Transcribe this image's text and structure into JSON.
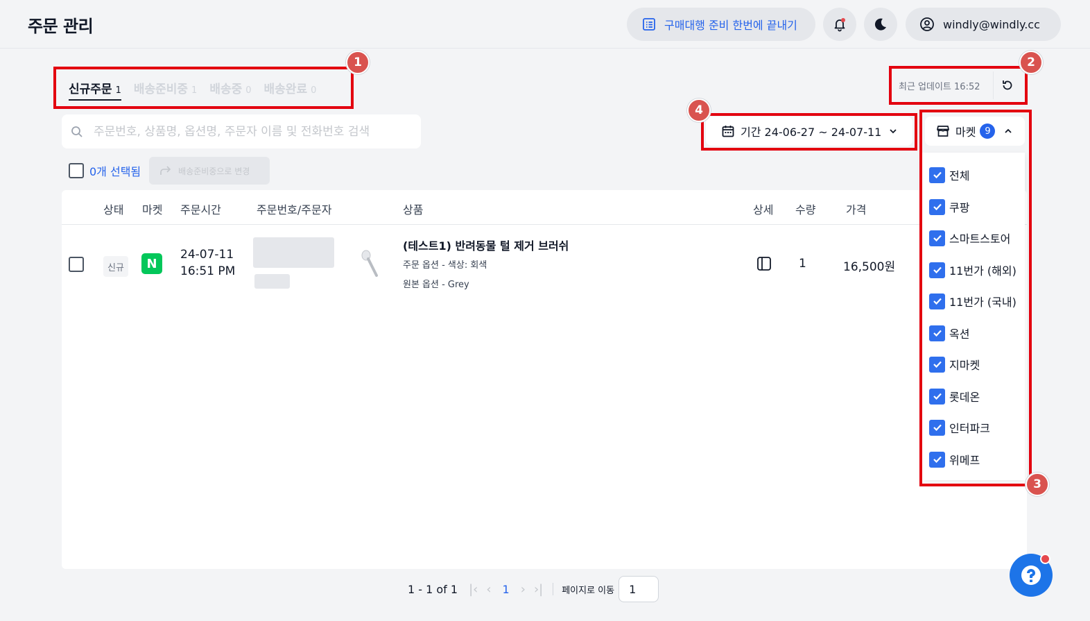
{
  "header": {
    "title": "주문 관리",
    "promo_label": "구매대행 준비 한번에 끝내기",
    "user_email": "windly@windly.cc"
  },
  "tabs": [
    {
      "label": "신규주문",
      "count": "1"
    },
    {
      "label": "배송준비중",
      "count": "1"
    },
    {
      "label": "배송중",
      "count": "0"
    },
    {
      "label": "배송완료",
      "count": "0"
    }
  ],
  "update": {
    "label": "최근 업데이트 16:52"
  },
  "search": {
    "placeholder": "주문번호, 상품명, 옵션명, 주문자 이름 및 전화번호 검색"
  },
  "period": {
    "label": "기간 24-06-27 ~ 24-07-11"
  },
  "market_filter": {
    "label": "마켓",
    "count": "9",
    "options": [
      "전체",
      "쿠팡",
      "스마트스토어",
      "11번가 (해외)",
      "11번가 (국내)",
      "옥션",
      "지마켓",
      "롯데온",
      "인터파크",
      "위메프"
    ]
  },
  "selection": {
    "selected_label": "0개 선택됨",
    "action_label": "배송준비중으로 변경"
  },
  "table": {
    "columns": [
      "상태",
      "마켓",
      "주문시간",
      "주문번호/주문자",
      "상품",
      "상세",
      "수량",
      "가격"
    ],
    "rows": [
      {
        "status": "신규",
        "market_logo": "N",
        "date": "24-07-11",
        "time": "16:51 PM",
        "product_name": "(테스트1) 반려동물 털 제거 브러쉬",
        "order_option": "주문 옵션 - 색상: 회색",
        "original_option": "원본 옵션 - Grey",
        "quantity": "1",
        "price": "16,500원"
      }
    ]
  },
  "pagination": {
    "range": "1 - 1 of 1",
    "current_page": "1",
    "goto_label": "페이지로 이동",
    "goto_value": "1"
  },
  "annotations": [
    "1",
    "2",
    "3",
    "4"
  ],
  "colors": {
    "accent": "#2563eb",
    "highlight": "#e3000f",
    "marker": "#d9534f",
    "naver_green": "#03c75a"
  }
}
